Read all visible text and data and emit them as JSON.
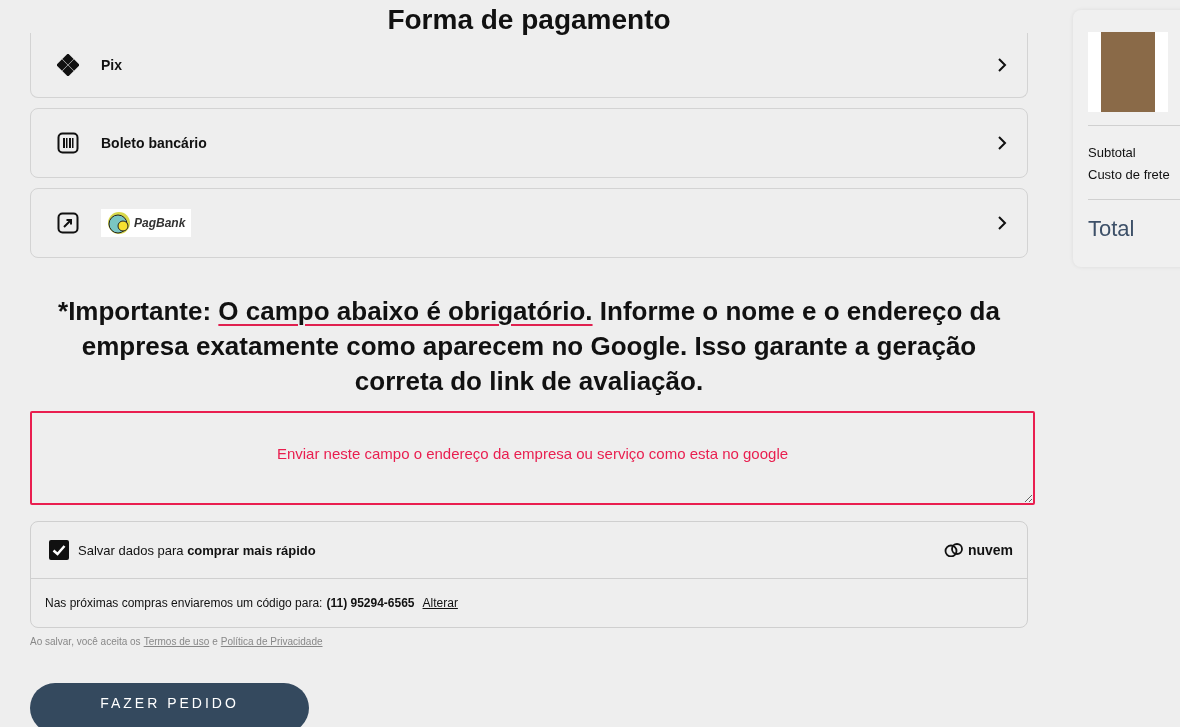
{
  "heading": "Forma de pagamento",
  "payment_methods": [
    {
      "kind": "pix",
      "label": "Pix"
    },
    {
      "kind": "boleto",
      "label": "Boleto bancário"
    },
    {
      "kind": "pagbank",
      "label": "PagBank"
    }
  ],
  "notice": {
    "lead": "*Importante:",
    "emphasis": "O campo abaixo é obrigatório.",
    "rest": "Informe o nome e o endereço da empresa exatamente como aparecem no Google. Isso garante a geração correta do link de avaliação."
  },
  "address_field": {
    "placeholder": "Enviar neste campo o endereço da empresa ou serviço como esta no google"
  },
  "save_data": {
    "checked": true,
    "label": "Salvar dados para **comprar mais rápido**",
    "brand": "nuvem",
    "code_text": "Nas próximas compras enviaremos um código para:",
    "phone": "(11) 95294-6565",
    "change_link": "Alterar"
  },
  "terms": {
    "prefix": "Ao salvar, você aceita os",
    "terms_link": "Termos de uso",
    "joiner": "e",
    "privacy_link": "Política de Privacidade"
  },
  "submit_button": "FAZER PEDIDO",
  "summary": {
    "subtotal_label": "Subtotal",
    "shipping_label": "Custo de frete",
    "total_label": "Total"
  }
}
